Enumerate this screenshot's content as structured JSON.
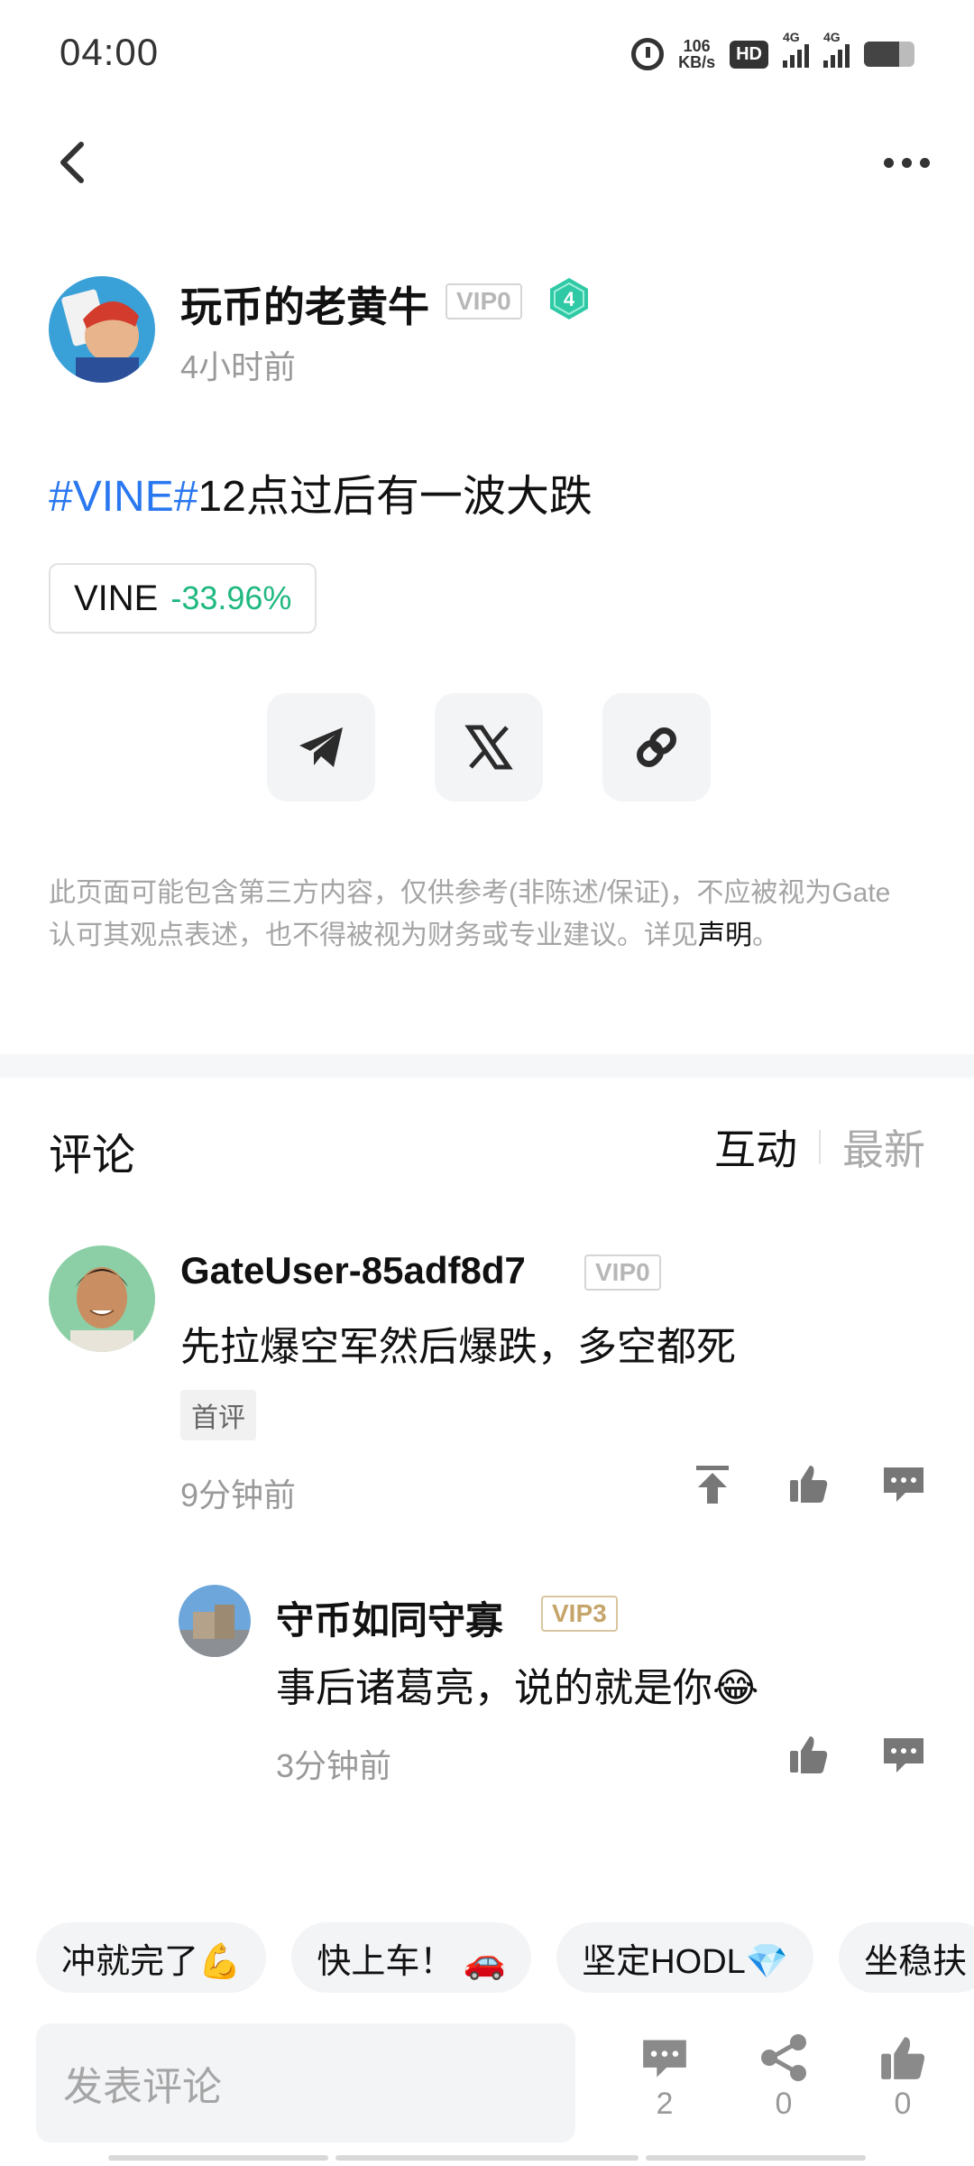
{
  "status_bar": {
    "time": "04:00",
    "net_speed_value": "106",
    "net_speed_unit": "KB/s",
    "hd": "HD",
    "signal1": "4G",
    "signal2": "4G",
    "battery_level": 0.7
  },
  "author": {
    "name": "玩币的老黄牛",
    "vip": "VIP0",
    "level": "4",
    "time": "4小时前"
  },
  "post": {
    "tag": "#VINE#",
    "text": "12点过后有一波大跌",
    "coin_name": "VINE",
    "coin_change": "-33.96%"
  },
  "disclaimer": {
    "text": "此页面可能包含第三方内容，仅供参考(非陈述/保证)，不应被视为Gate认可其观点表述，也不得被视为财务或专业建议。详见",
    "link": "声明",
    "end": "。"
  },
  "comments": {
    "title": "评论",
    "sort_active": "互动",
    "sort_inactive": "最新",
    "first": {
      "user": "GateUser-85adf8d7",
      "vip": "VIP0",
      "text": "先拉爆空军然后爆跌，多空都死",
      "tag": "首评",
      "time": "9分钟前"
    },
    "reply": {
      "user": "守币如同守寡",
      "vip": "VIP3",
      "text": "事后诸葛亮，说的就是你😂",
      "time": "3分钟前"
    }
  },
  "quick_replies": [
    "冲就完了💪",
    "快上车！ 🚗",
    "坚定HODL💎",
    "坐稳扶"
  ],
  "bottom_bar": {
    "placeholder": "发表评论",
    "comment_count": "2",
    "share_count": "0",
    "like_count": "0"
  },
  "colors": {
    "tag_blue": "#2a78f0",
    "change_green": "#1fb87f",
    "level_teal": "#2fc9a6"
  }
}
